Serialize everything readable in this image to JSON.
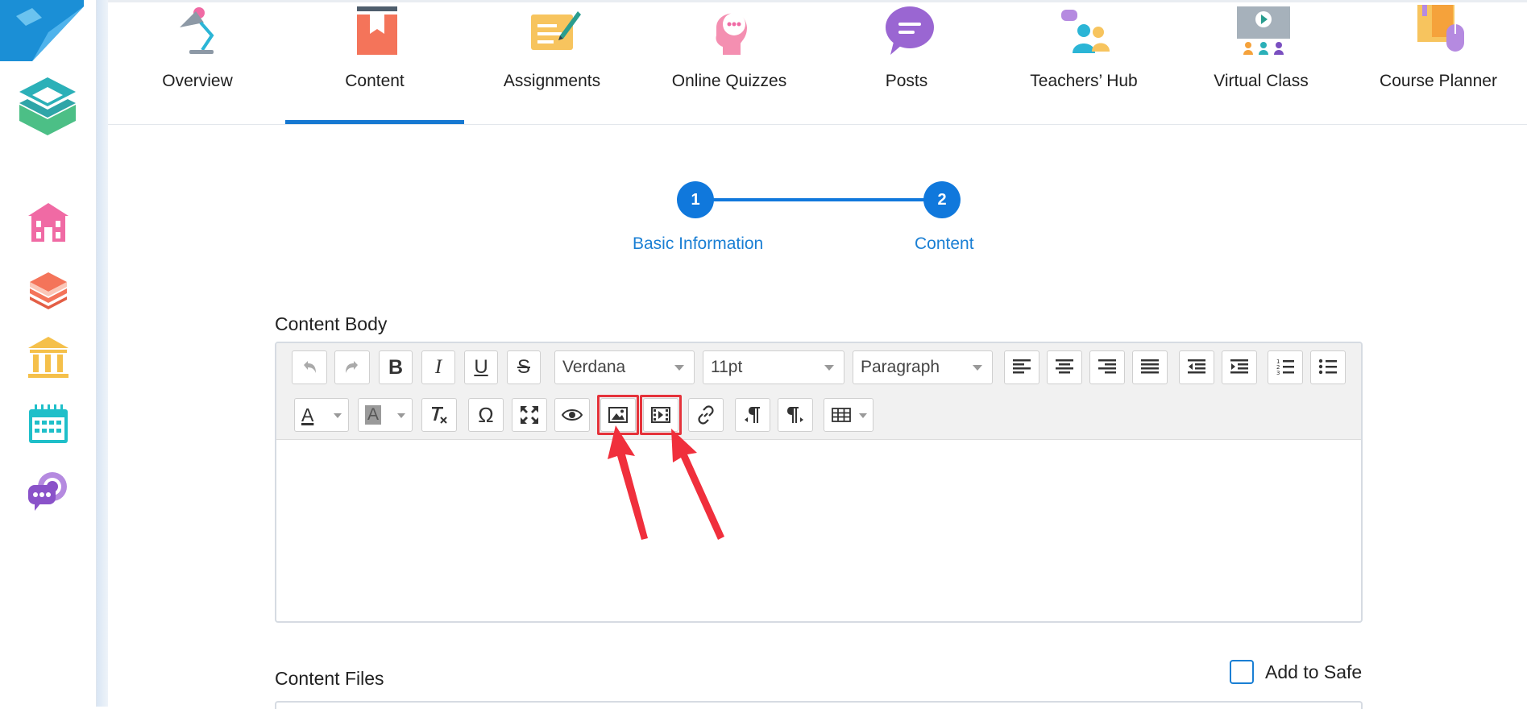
{
  "nav": {
    "tabs": [
      {
        "label": "Overview",
        "icon": "lamp-icon"
      },
      {
        "label": "Content",
        "icon": "book-icon",
        "active": true
      },
      {
        "label": "Assignments",
        "icon": "pen-paper-icon"
      },
      {
        "label": "Online Quizzes",
        "icon": "head-chat-icon"
      },
      {
        "label": "Posts",
        "icon": "speech-bubble-icon"
      },
      {
        "label": "Teachers’ Hub",
        "icon": "people-chat-icon"
      },
      {
        "label": "Virtual Class",
        "icon": "presentation-icon"
      },
      {
        "label": "Course Planner",
        "icon": "planner-mouse-icon"
      }
    ],
    "accent": "#1678d1"
  },
  "sidebar": {
    "items": [
      {
        "icon": "school-icon",
        "color": "#f06aa4"
      },
      {
        "icon": "books-stack-icon",
        "color": "#f4745a"
      },
      {
        "icon": "institution-icon",
        "color": "#f5c04a"
      },
      {
        "icon": "calendar-icon",
        "color": "#1fbfc9"
      },
      {
        "icon": "chat-bubbles-icon",
        "color": "#8a52c9"
      }
    ]
  },
  "stepper": {
    "steps": [
      {
        "number": "1",
        "label": "Basic Information"
      },
      {
        "number": "2",
        "label": "Content"
      }
    ]
  },
  "editor": {
    "title": "Content Body",
    "font_family": "Verdana",
    "font_size": "11pt",
    "block_format": "Paragraph",
    "highlighted_buttons": [
      "insert-image-button",
      "insert-media-button"
    ]
  },
  "files": {
    "title": "Content Files",
    "add_to_safe_label": "Add to Safe",
    "add_to_safe_checked": false
  }
}
